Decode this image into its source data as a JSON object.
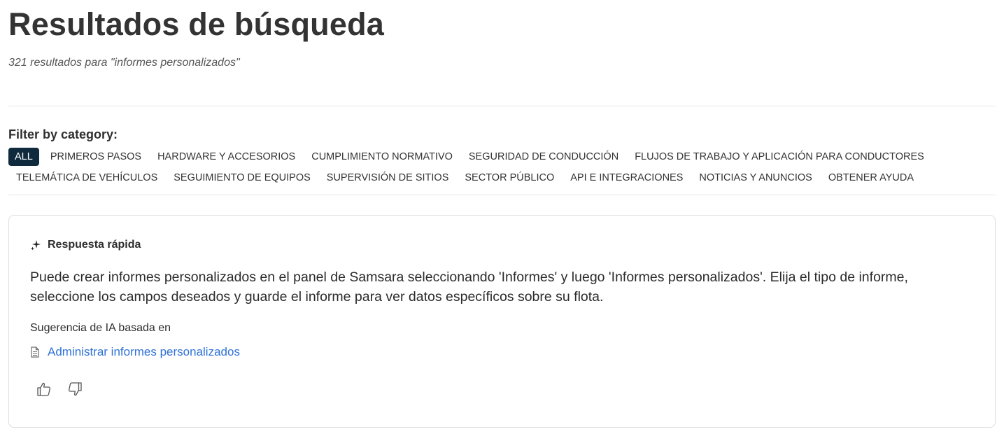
{
  "header": {
    "title": "Resultados de búsqueda",
    "results_summary": "321 resultados para \"informes personalizados\""
  },
  "filters": {
    "label": "Filter by category:",
    "row1": [
      {
        "label": "ALL",
        "active": true
      },
      {
        "label": "PRIMEROS PASOS"
      },
      {
        "label": "HARDWARE Y ACCESORIOS"
      },
      {
        "label": "CUMPLIMIENTO NORMATIVO"
      },
      {
        "label": "SEGURIDAD DE CONDUCCIÓN"
      },
      {
        "label": "FLUJOS DE TRABAJO Y APLICACIÓN PARA CONDUCTORES"
      }
    ],
    "row2": [
      {
        "label": "TELEMÁTICA DE VEHÍCULOS"
      },
      {
        "label": "SEGUIMIENTO DE EQUIPOS"
      },
      {
        "label": "SUPERVISIÓN DE SITIOS"
      },
      {
        "label": "SECTOR PÚBLICO"
      },
      {
        "label": "API E INTEGRACIONES"
      },
      {
        "label": "NOTICIAS Y ANUNCIOS"
      },
      {
        "label": "OBTENER AYUDA"
      }
    ]
  },
  "quick_answer": {
    "icon": "sparkle-icon",
    "title": "Respuesta rápida",
    "text": "Puede crear informes personalizados en el panel de Samsara seleccionando 'Informes' y luego 'Informes personalizados'. Elija el tipo de informe, seleccione los campos deseados y guarde el informe para ver datos específicos sobre su flota.",
    "basis_label": "Sugerencia de IA basada en",
    "source_icon": "document-icon",
    "source_link": "Administrar informes personalizados",
    "feedback": {
      "up_icon": "thumbs-up-icon",
      "down_icon": "thumbs-down-icon"
    }
  },
  "colors": {
    "active_chip_bg": "#0f2a3d",
    "link": "#2f72d6",
    "border": "#dedede"
  }
}
